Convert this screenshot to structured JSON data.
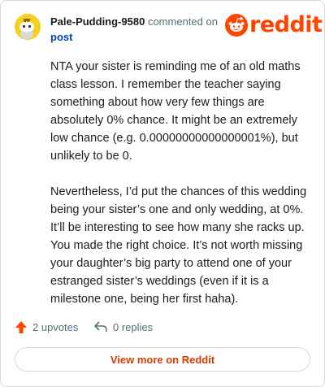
{
  "comment": {
    "username": "Pale-Pudding-9580",
    "action_text": "commented on",
    "post_link": "post",
    "paragraphs": [
      "NTA your sister is reminding me of an old maths class lesson. I remember the teacher saying something about how very few things are absolutely 0% chance. It might be an extremely low chance (e.g. 0.00000000000000001%), but unlikely to be 0.",
      "Nevertheless, I’d put the chances of this wedding being your sister’s one and only wedding, at 0%. It’ll be interesting to see how many she racks up. You made the right choice. It’s not worth missing your daughter’s big party to attend one of your estranged sister’s weddings (even if it is a milestone one, being her first haha)."
    ]
  },
  "brand": {
    "name": "reddit",
    "color": "#ff4500"
  },
  "footer": {
    "upvotes_label": "2 upvotes",
    "replies_label": "0 replies",
    "view_more_label": "View more on Reddit"
  },
  "icons": {
    "avatar": "snoo-avatar-icon",
    "logo": "reddit-snoo-icon",
    "upvote": "upvote-arrow-icon",
    "reply": "reply-arrow-icon"
  }
}
